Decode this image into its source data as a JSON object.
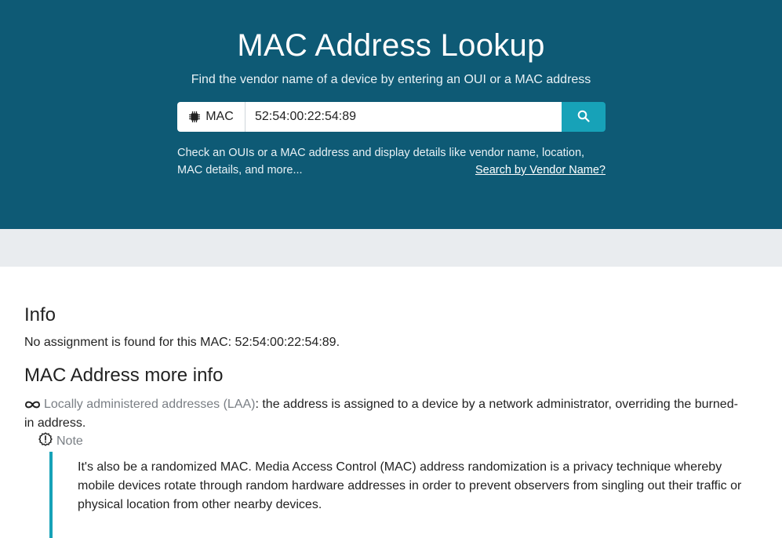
{
  "header": {
    "title": "MAC Address Lookup",
    "subtitle": "Find the vendor name of a device by entering an OUI or a MAC address"
  },
  "search": {
    "type_label": "MAC",
    "type_icon": "chip-icon",
    "value": "52:54:00:22:54:89",
    "button_icon": "search-icon"
  },
  "description": {
    "text": "Check an OUIs or a MAC address and display details like vendor name, location, MAC details, and more...",
    "vendor_link": "Search by Vendor Name?"
  },
  "info": {
    "heading": "Info",
    "text": "No assignment is found for this MAC: 52:54:00:22:54:89."
  },
  "more_info": {
    "heading": "MAC Address more info",
    "laa_icon": "infinity-icon",
    "laa_term": "Locally administered addresses (LAA)",
    "laa_text": ": the address is assigned to a device by a network administrator, overriding the burned-in address.",
    "note_label": "Note",
    "note_text": "It's also be a randomized MAC. Media Access Control (MAC) address randomization is a privacy technique whereby mobile devices rotate through random hardware addresses in order to prevent observers from singling out their traffic or physical location from other nearby devices."
  },
  "colors": {
    "hero_bg": "#0e5a75",
    "accent": "#17a2b8",
    "band": "#e9ecef"
  }
}
